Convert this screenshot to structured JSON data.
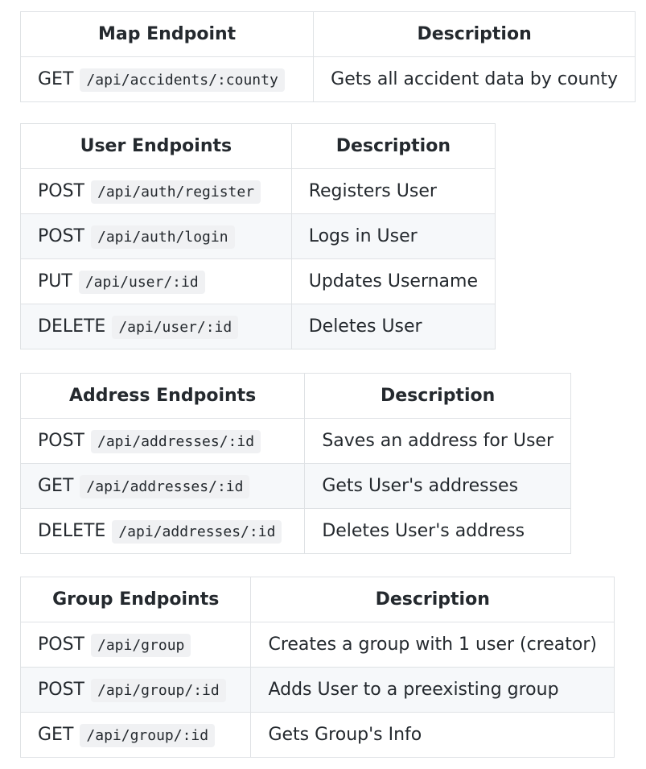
{
  "tables": [
    {
      "header": "Map Endpoint",
      "desc_header": "Description",
      "rows": [
        {
          "method": "GET",
          "path": "/api/accidents/:county",
          "description": "Gets all accident data by county"
        }
      ]
    },
    {
      "header": "User Endpoints",
      "desc_header": "Description",
      "rows": [
        {
          "method": "POST",
          "path": "/api/auth/register",
          "description": "Registers User"
        },
        {
          "method": "POST",
          "path": "/api/auth/login",
          "description": "Logs in User"
        },
        {
          "method": "PUT",
          "path": "/api/user/:id",
          "description": "Updates Username"
        },
        {
          "method": "DELETE",
          "path": "/api/user/:id",
          "description": "Deletes User"
        }
      ]
    },
    {
      "header": "Address Endpoints",
      "desc_header": "Description",
      "rows": [
        {
          "method": "POST",
          "path": "/api/addresses/:id",
          "description": "Saves an address for User"
        },
        {
          "method": "GET",
          "path": "/api/addresses/:id",
          "description": "Gets User's addresses"
        },
        {
          "method": "DELETE",
          "path": "/api/addresses/:id",
          "description": "Deletes User's address"
        }
      ]
    },
    {
      "header": "Group Endpoints",
      "desc_header": "Description",
      "rows": [
        {
          "method": "POST",
          "path": "/api/group",
          "description": "Creates a group with 1 user (creator)"
        },
        {
          "method": "POST",
          "path": "/api/group/:id",
          "description": "Adds User to a preexisting group"
        },
        {
          "method": "GET",
          "path": "/api/group/:id",
          "description": "Gets Group's Info"
        }
      ]
    }
  ]
}
